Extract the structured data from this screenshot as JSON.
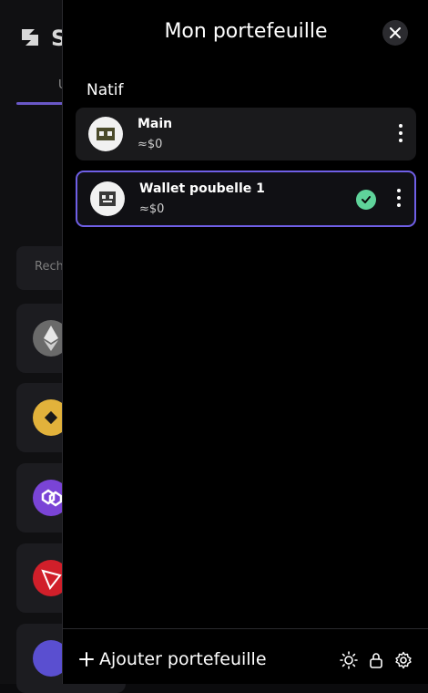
{
  "background": {
    "logo_letter": "S",
    "tab_text": "U",
    "search_placeholder": "Rech"
  },
  "panel": {
    "title": "Mon portefeuille",
    "section_label": "Natif",
    "wallets": [
      {
        "name": "Main",
        "balance": "≈$0",
        "selected": false
      },
      {
        "name": "Wallet poubelle 1",
        "balance": "≈$0",
        "selected": true
      }
    ],
    "footer": {
      "add_label": "Ajouter portefeuille"
    }
  },
  "colors": {
    "accent": "#6f5fe6",
    "check": "#5fd39a",
    "panel_bg": "#000000",
    "card_bg": "#1a1a1c"
  },
  "icons": [
    "close-icon",
    "more-vertical-icon",
    "check-icon",
    "plus-icon",
    "sun-icon",
    "lock-icon",
    "gear-icon"
  ]
}
